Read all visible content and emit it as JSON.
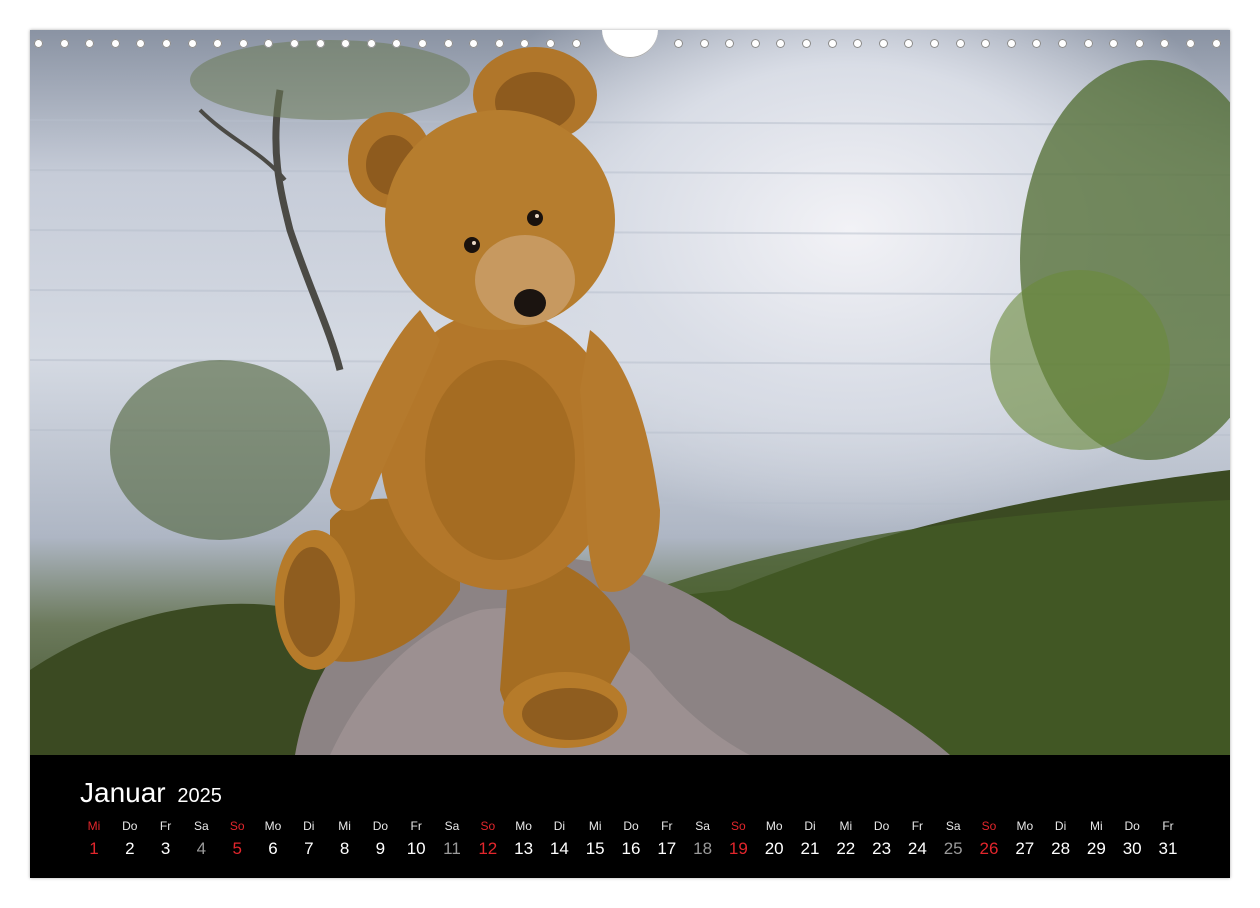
{
  "calendar": {
    "month": "Januar",
    "year": "2025",
    "days": [
      {
        "dn": "Mi",
        "dd": "1",
        "type": "sun"
      },
      {
        "dn": "Do",
        "dd": "2",
        "type": "wd"
      },
      {
        "dn": "Fr",
        "dd": "3",
        "type": "wd"
      },
      {
        "dn": "Sa",
        "dd": "4",
        "type": "sat"
      },
      {
        "dn": "So",
        "dd": "5",
        "type": "sun"
      },
      {
        "dn": "Mo",
        "dd": "6",
        "type": "wd"
      },
      {
        "dn": "Di",
        "dd": "7",
        "type": "wd"
      },
      {
        "dn": "Mi",
        "dd": "8",
        "type": "wd"
      },
      {
        "dn": "Do",
        "dd": "9",
        "type": "wd"
      },
      {
        "dn": "Fr",
        "dd": "10",
        "type": "wd"
      },
      {
        "dn": "Sa",
        "dd": "11",
        "type": "sat"
      },
      {
        "dn": "So",
        "dd": "12",
        "type": "sun"
      },
      {
        "dn": "Mo",
        "dd": "13",
        "type": "wd"
      },
      {
        "dn": "Di",
        "dd": "14",
        "type": "wd"
      },
      {
        "dn": "Mi",
        "dd": "15",
        "type": "wd"
      },
      {
        "dn": "Do",
        "dd": "16",
        "type": "wd"
      },
      {
        "dn": "Fr",
        "dd": "17",
        "type": "wd"
      },
      {
        "dn": "Sa",
        "dd": "18",
        "type": "sat"
      },
      {
        "dn": "So",
        "dd": "19",
        "type": "sun"
      },
      {
        "dn": "Mo",
        "dd": "20",
        "type": "wd"
      },
      {
        "dn": "Di",
        "dd": "21",
        "type": "wd"
      },
      {
        "dn": "Mi",
        "dd": "22",
        "type": "wd"
      },
      {
        "dn": "Do",
        "dd": "23",
        "type": "wd"
      },
      {
        "dn": "Fr",
        "dd": "24",
        "type": "wd"
      },
      {
        "dn": "Sa",
        "dd": "25",
        "type": "sat"
      },
      {
        "dn": "So",
        "dd": "26",
        "type": "sun"
      },
      {
        "dn": "Mo",
        "dd": "27",
        "type": "wd"
      },
      {
        "dn": "Di",
        "dd": "28",
        "type": "wd"
      },
      {
        "dn": "Mi",
        "dd": "29",
        "type": "wd"
      },
      {
        "dn": "Do",
        "dd": "30",
        "type": "wd"
      },
      {
        "dn": "Fr",
        "dd": "31",
        "type": "wd"
      }
    ]
  },
  "colors": {
    "sunday": "#e2262c",
    "saturday": "#9a9a9a",
    "bar": "#000000"
  },
  "photo": {
    "subject": "teddy-bear-on-rock"
  }
}
